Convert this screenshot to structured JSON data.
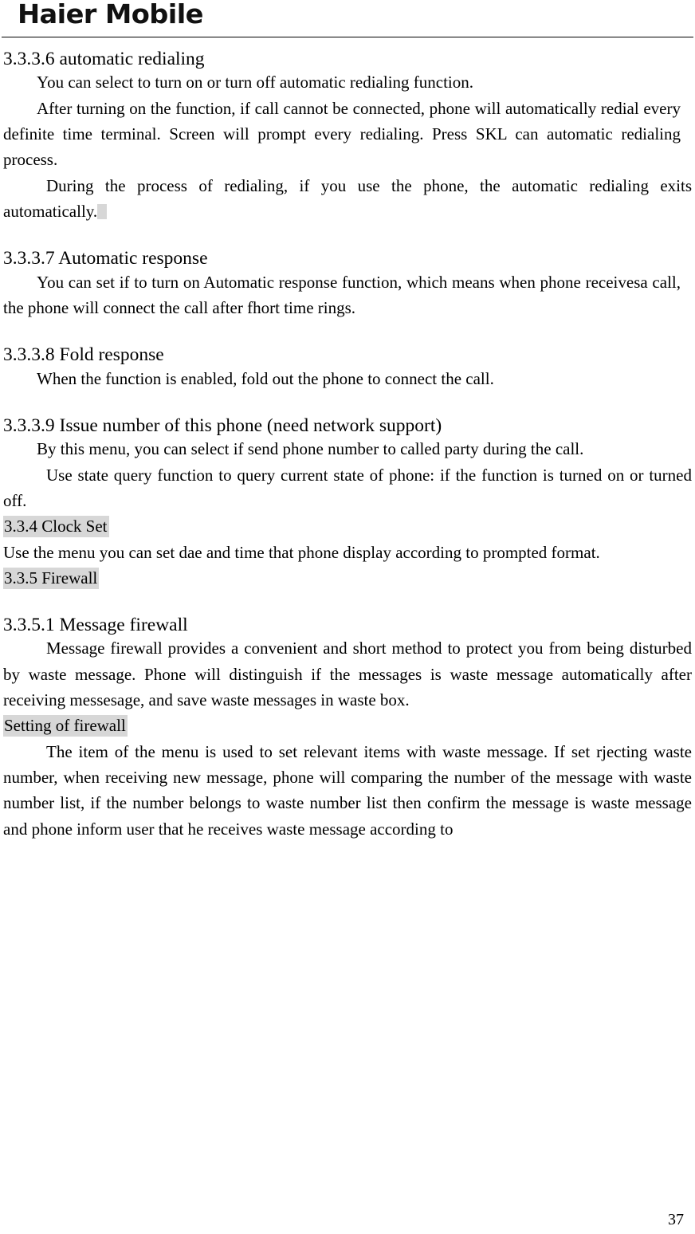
{
  "header": {
    "brand": "Haier Mobile"
  },
  "sections": [
    {
      "id": "automatic-redialing",
      "heading": "3.3.3.6 automatic redialing",
      "paragraphs": [
        "You can select to turn on or turn off automatic redialing function.",
        "After turning on the function, if call cannot be connected, phone will automatically redial every definite time terminal. Screen will prompt every redialing. Press SKL can automatic redialing process.",
        "During the process of redialing, if you use the phone, the automatic redialing exits automatically."
      ]
    },
    {
      "id": "automatic-response",
      "heading": "3.3.3.7 Automatic response",
      "paragraphs": [
        "You can set if to turn on Automatic response function, which means when phone receivesa call, the phone will connect the call after fhort time rings."
      ]
    },
    {
      "id": "fold-response",
      "heading": "3.3.3.8 Fold response",
      "paragraphs": [
        "When the function is enabled, fold out the phone to connect the call."
      ]
    },
    {
      "id": "issue-number",
      "heading": "3.3.3.9 Issue number of this phone (need network support)",
      "paragraphs": [
        "By this menu, you can select if send phone number to called party during the call.",
        "Use state query function to query current state of phone: if the function is turned on or turned off."
      ]
    },
    {
      "id": "clock-set",
      "heading": "3.3.4 Clock Set",
      "paragraphs": [
        "Use the menu you can set dae and time that phone display according to prompted format."
      ]
    },
    {
      "id": "firewall",
      "heading": "3.3.5 Firewall",
      "paragraphs": []
    },
    {
      "id": "message-firewall",
      "heading": "3.3.5.1 Message firewall",
      "paragraphs": [
        "Message firewall provides a convenient and short method to protect you from being disturbed by waste message. Phone will distinguish if the messages is waste message automatically after receiving messesage, and save waste messages in waste box."
      ]
    },
    {
      "id": "setting-of-firewall",
      "heading": "Setting of firewall",
      "paragraphs": [
        "The item of the menu is used to set relevant items with waste message. If set rjecting waste number, when receiving new message, phone will comparing the number of the message with waste number list, if the number belongs to waste number list then confirm the message is waste message and phone inform user that he receives waste message according to"
      ]
    }
  ],
  "footer": {
    "page_number": "37"
  }
}
